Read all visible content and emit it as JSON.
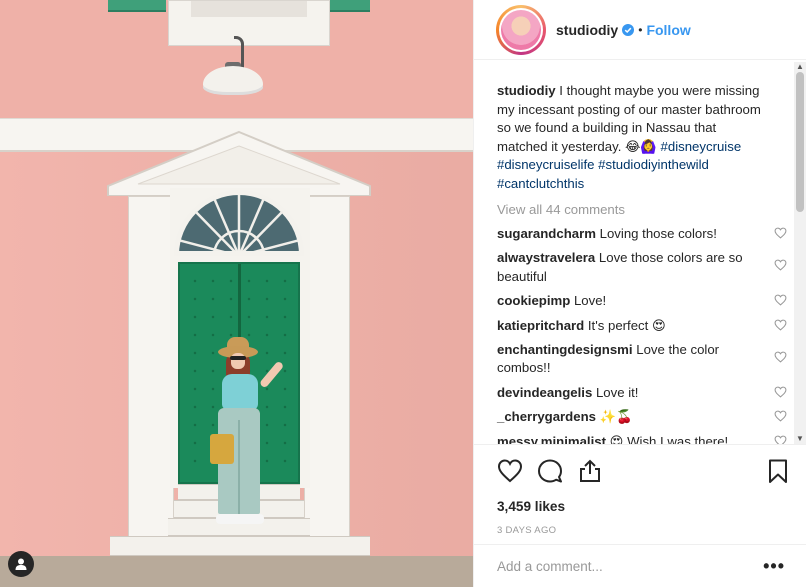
{
  "header": {
    "username": "studiodiy",
    "separator": "•",
    "follow_label": "Follow"
  },
  "caption": {
    "username": "studiodiy",
    "text": "I thought maybe you were missing my incessant posting of our master bathroom so we found a building in Nassau that matched it yesterday. 😂🙆‍♀️",
    "hashtags": [
      "#disneycruise",
      "#disneycruiselife",
      "#studiodiyinthewild",
      "#cantclutchthis"
    ]
  },
  "view_all": "View all 44 comments",
  "comments": [
    {
      "user": "sugarandcharm",
      "text": "Loving those colors!"
    },
    {
      "user": "alwaystravelera",
      "text": "Love those colors are so beautiful"
    },
    {
      "user": "cookiepimp",
      "text": "Love!"
    },
    {
      "user": "katiepritchard",
      "text": "It's perfect 😍"
    },
    {
      "user": "enchantingdesignsmi",
      "text": "Love the color combos!!"
    },
    {
      "user": "devindeangelis",
      "text": "Love it!"
    },
    {
      "user": "_cherrygardens",
      "text": "✨🍒"
    },
    {
      "user": "messy.minimalist",
      "text": "😍 Wish I was there!"
    }
  ],
  "likes": "3,459 likes",
  "timestamp": "3 DAYS AGO",
  "add_comment_placeholder": "Add a comment...",
  "more_options": "•••",
  "icons": {
    "like": "heart-icon",
    "comment": "comment-icon",
    "share": "share-icon",
    "save": "bookmark-icon",
    "verified": "verified-badge-icon",
    "user_tag": "user-tag-icon"
  },
  "colors": {
    "follow_blue": "#3897f0",
    "hashtag": "#003569",
    "muted": "#999999",
    "text": "#262626"
  }
}
